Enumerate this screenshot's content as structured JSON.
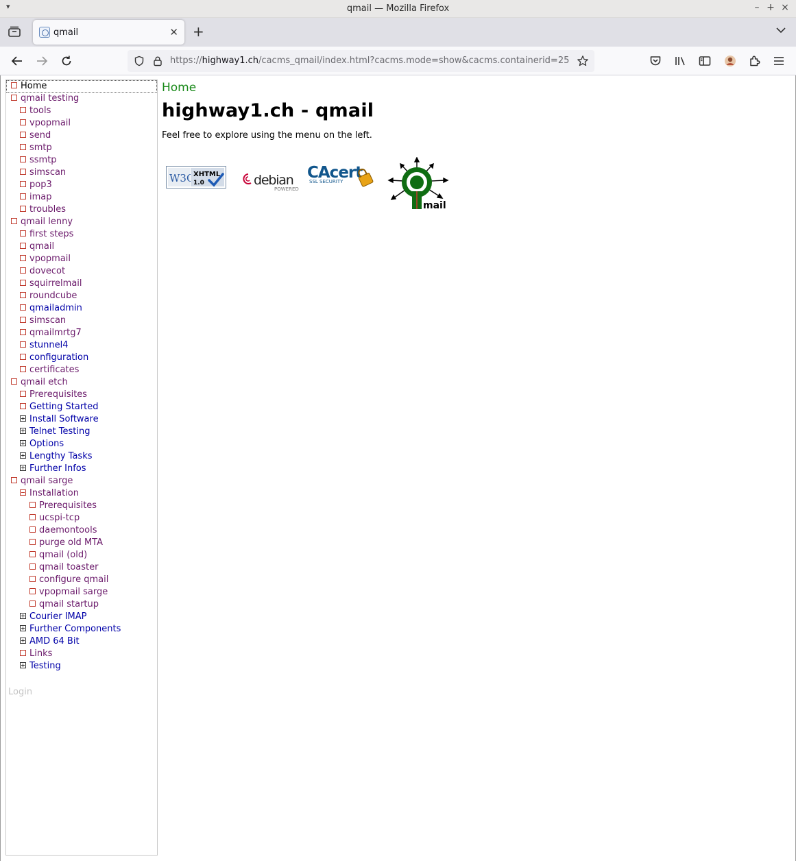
{
  "window": {
    "title": "qmail — Mozilla Firefox"
  },
  "tab": {
    "title": "qmail"
  },
  "url": {
    "prefix": "https://",
    "host": "highway1.ch",
    "path": "/cacms_qmail/index.html?cacms.mode=show&cacms.containerid=25"
  },
  "breadcrumb": "Home",
  "page": {
    "title": "highway1.ch - qmail",
    "intro": "Feel free to explore using the menu on the left."
  },
  "badges": {
    "w3c": {
      "left": "W3C",
      "line1": "XHTML",
      "line2": "1.0"
    },
    "debian": {
      "word": "debian",
      "sub": "POWERED"
    },
    "cacert": {
      "word": "CAcert",
      "sub": "SSL SECURITY"
    },
    "qmail": {
      "word": "mail"
    }
  },
  "menu": [
    {
      "label": "Home",
      "level": 0,
      "icon": "box",
      "color": "black",
      "selected": true
    },
    {
      "label": "qmail testing",
      "level": 0,
      "icon": "box",
      "color": "visited"
    },
    {
      "label": "tools",
      "level": 1,
      "icon": "box",
      "color": "visited"
    },
    {
      "label": "vpopmail",
      "level": 1,
      "icon": "box",
      "color": "visited"
    },
    {
      "label": "send",
      "level": 1,
      "icon": "box",
      "color": "visited"
    },
    {
      "label": "smtp",
      "level": 1,
      "icon": "box",
      "color": "visited"
    },
    {
      "label": "ssmtp",
      "level": 1,
      "icon": "box",
      "color": "visited"
    },
    {
      "label": "simscan",
      "level": 1,
      "icon": "box",
      "color": "visited"
    },
    {
      "label": "pop3",
      "level": 1,
      "icon": "box",
      "color": "visited"
    },
    {
      "label": "imap",
      "level": 1,
      "icon": "box",
      "color": "visited"
    },
    {
      "label": "troubles",
      "level": 1,
      "icon": "box",
      "color": "visited"
    },
    {
      "label": "qmail lenny",
      "level": 0,
      "icon": "box",
      "color": "visited"
    },
    {
      "label": "first steps",
      "level": 1,
      "icon": "box",
      "color": "visited"
    },
    {
      "label": "qmail",
      "level": 1,
      "icon": "box",
      "color": "visited"
    },
    {
      "label": "vpopmail",
      "level": 1,
      "icon": "box",
      "color": "visited"
    },
    {
      "label": "dovecot",
      "level": 1,
      "icon": "box",
      "color": "visited"
    },
    {
      "label": "squirrelmail",
      "level": 1,
      "icon": "box",
      "color": "visited"
    },
    {
      "label": "roundcube",
      "level": 1,
      "icon": "box",
      "color": "visited"
    },
    {
      "label": "qmailadmin",
      "level": 1,
      "icon": "box",
      "color": "link"
    },
    {
      "label": "simscan",
      "level": 1,
      "icon": "box",
      "color": "visited"
    },
    {
      "label": "qmailmrtg7",
      "level": 1,
      "icon": "box",
      "color": "visited"
    },
    {
      "label": "stunnel4",
      "level": 1,
      "icon": "box",
      "color": "link"
    },
    {
      "label": "configuration",
      "level": 1,
      "icon": "box",
      "color": "link"
    },
    {
      "label": "certificates",
      "level": 1,
      "icon": "box",
      "color": "visited"
    },
    {
      "label": "qmail etch",
      "level": 0,
      "icon": "box",
      "color": "visited"
    },
    {
      "label": "Prerequisites",
      "level": 1,
      "icon": "box",
      "color": "visited"
    },
    {
      "label": "Getting Started",
      "level": 1,
      "icon": "box",
      "color": "link"
    },
    {
      "label": "Install Software",
      "level": 1,
      "icon": "plus",
      "color": "link"
    },
    {
      "label": "Telnet Testing",
      "level": 1,
      "icon": "plus",
      "color": "link"
    },
    {
      "label": "Options",
      "level": 1,
      "icon": "plus",
      "color": "link"
    },
    {
      "label": "Lengthy Tasks",
      "level": 1,
      "icon": "plus",
      "color": "link"
    },
    {
      "label": "Further Infos",
      "level": 1,
      "icon": "plus",
      "color": "link"
    },
    {
      "label": "qmail sarge",
      "level": 0,
      "icon": "box",
      "color": "visited"
    },
    {
      "label": "Installation",
      "level": 1,
      "icon": "minus",
      "color": "visited"
    },
    {
      "label": "Prerequisites",
      "level": 2,
      "icon": "box",
      "color": "visited"
    },
    {
      "label": "ucspi-tcp",
      "level": 2,
      "icon": "box",
      "color": "visited"
    },
    {
      "label": "daemontools",
      "level": 2,
      "icon": "box",
      "color": "visited"
    },
    {
      "label": "purge old MTA",
      "level": 2,
      "icon": "box",
      "color": "visited"
    },
    {
      "label": "qmail (old)",
      "level": 2,
      "icon": "box",
      "color": "visited"
    },
    {
      "label": "qmail toaster",
      "level": 2,
      "icon": "box",
      "color": "visited"
    },
    {
      "label": "configure qmail",
      "level": 2,
      "icon": "box",
      "color": "visited"
    },
    {
      "label": "vpopmail sarge",
      "level": 2,
      "icon": "box",
      "color": "visited"
    },
    {
      "label": "qmail startup",
      "level": 2,
      "icon": "box",
      "color": "visited"
    },
    {
      "label": "Courier IMAP",
      "level": 1,
      "icon": "plus",
      "color": "link"
    },
    {
      "label": "Further Components",
      "level": 1,
      "icon": "plus",
      "color": "link"
    },
    {
      "label": "AMD 64 Bit",
      "level": 1,
      "icon": "plus",
      "color": "link"
    },
    {
      "label": "Links",
      "level": 1,
      "icon": "box",
      "color": "visited"
    },
    {
      "label": "Testing",
      "level": 1,
      "icon": "plus",
      "color": "link"
    }
  ],
  "login": "Login",
  "colors": {
    "breadcrumb": "#1a8a1a",
    "visited": "#6b1a6b",
    "link": "#0000a8",
    "box": "#c0392b"
  }
}
